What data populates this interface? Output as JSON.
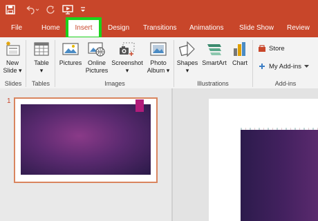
{
  "colors": {
    "accent": "#c8462a",
    "highlight": "#1bd21b",
    "slide_purple": "#5b2a70"
  },
  "quick_access": {
    "icons": [
      "save-icon",
      "undo-icon",
      "redo-icon",
      "start-from-beginning-icon",
      "customize-qat-icon"
    ]
  },
  "tabs": [
    "File",
    "Home",
    "Insert",
    "Design",
    "Transitions",
    "Animations",
    "Slide Show",
    "Review"
  ],
  "active_tab": "Insert",
  "ribbon": {
    "new_slide": {
      "line1": "New",
      "line2": "Slide ▾"
    },
    "table": {
      "line1": "Table",
      "line2": "▾"
    },
    "pictures": "Pictures",
    "online_pictures": {
      "line1": "Online",
      "line2": "Pictures"
    },
    "screenshot": {
      "line1": "Screenshot",
      "line2": "▾"
    },
    "photo_album": {
      "line1": "Photo",
      "line2": "Album ▾"
    },
    "shapes": {
      "line1": "Shapes",
      "line2": "▾"
    },
    "smartart": "SmartArt",
    "chart": "Chart",
    "store": "Store",
    "my_addins": "My Add-ins",
    "groups": {
      "slides": "Slides",
      "tables": "Tables",
      "images": "Images",
      "illustrations": "Illustrations",
      "addins": "Add-ins"
    }
  },
  "slide_panel": {
    "slide_number": "1"
  }
}
